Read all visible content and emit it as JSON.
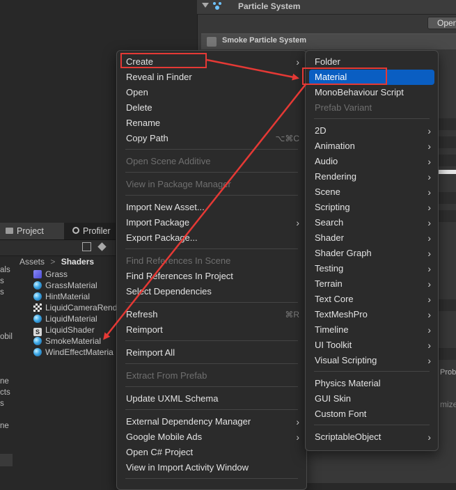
{
  "inspector": {
    "title": "Particle System",
    "open_button": "Open",
    "component_title": "Smoke Particle System",
    "cut_label_1": "Prob",
    "cut_label_2": "mize"
  },
  "project_panel": {
    "tabs": [
      {
        "label": "Project",
        "icon": "folder-icon"
      },
      {
        "label": "Profiler",
        "icon": "profiler-icon"
      }
    ],
    "breadcrumb": {
      "root": "Assets",
      "separator": ">",
      "current": "Shaders"
    },
    "left_cut_labels": [
      "als",
      "s",
      "s",
      "obil",
      "ne",
      "cts",
      "s",
      "ne"
    ],
    "assets": [
      {
        "name": "Grass",
        "icon": "grass-icon"
      },
      {
        "name": "GrassMaterial",
        "icon": "material-icon"
      },
      {
        "name": "HintMaterial",
        "icon": "material-icon"
      },
      {
        "name": "LiquidCameraRend",
        "icon": "render-texture-icon"
      },
      {
        "name": "LiquidMaterial",
        "icon": "material-icon"
      },
      {
        "name": "LiquidShader",
        "icon": "shader-icon"
      },
      {
        "name": "SmokeMaterial",
        "icon": "material-icon"
      },
      {
        "name": "WindEffectMateria",
        "icon": "material-icon"
      }
    ]
  },
  "context_menu": {
    "create": "Create",
    "reveal_in_finder": "Reveal in Finder",
    "open": "Open",
    "delete": "Delete",
    "rename": "Rename",
    "copy_path": "Copy Path",
    "copy_path_shortcut": "⌥⌘C",
    "open_scene_additive": "Open Scene Additive",
    "view_in_package_manager": "View in Package Manager",
    "import_new_asset": "Import New Asset...",
    "import_package": "Import Package",
    "export_package": "Export Package...",
    "find_references_in_scene": "Find References In Scene",
    "find_references_in_project": "Find References In Project",
    "select_dependencies": "Select Dependencies",
    "refresh": "Refresh",
    "refresh_shortcut": "⌘R",
    "reimport": "Reimport",
    "reimport_all": "Reimport All",
    "extract_from_prefab": "Extract From Prefab",
    "update_uxml_schema": "Update UXML Schema",
    "external_dependency_manager": "External Dependency Manager",
    "google_mobile_ads": "Google Mobile Ads",
    "open_csharp_project": "Open C# Project",
    "view_in_import_activity_window": "View in Import Activity Window"
  },
  "create_submenu": {
    "folder": "Folder",
    "material": "Material",
    "monobehaviour_script": "MonoBehaviour Script",
    "prefab_variant": "Prefab Variant",
    "2d": "2D",
    "animation": "Animation",
    "audio": "Audio",
    "rendering": "Rendering",
    "scene": "Scene",
    "scripting": "Scripting",
    "search": "Search",
    "shader": "Shader",
    "shader_graph": "Shader Graph",
    "testing": "Testing",
    "terrain": "Terrain",
    "text_core": "Text Core",
    "textmeshpro": "TextMeshPro",
    "timeline": "Timeline",
    "ui_toolkit": "UI Toolkit",
    "visual_scripting": "Visual Scripting",
    "physics_material": "Physics Material",
    "gui_skin": "GUI Skin",
    "custom_font": "Custom Font",
    "scriptable_object": "ScriptableObject"
  },
  "glyphs": {
    "submenu_arrow": "›"
  },
  "colors": {
    "highlight": "#0a5ec2",
    "annotation_red": "#e53935",
    "menu_bg": "#2b2b2b"
  }
}
